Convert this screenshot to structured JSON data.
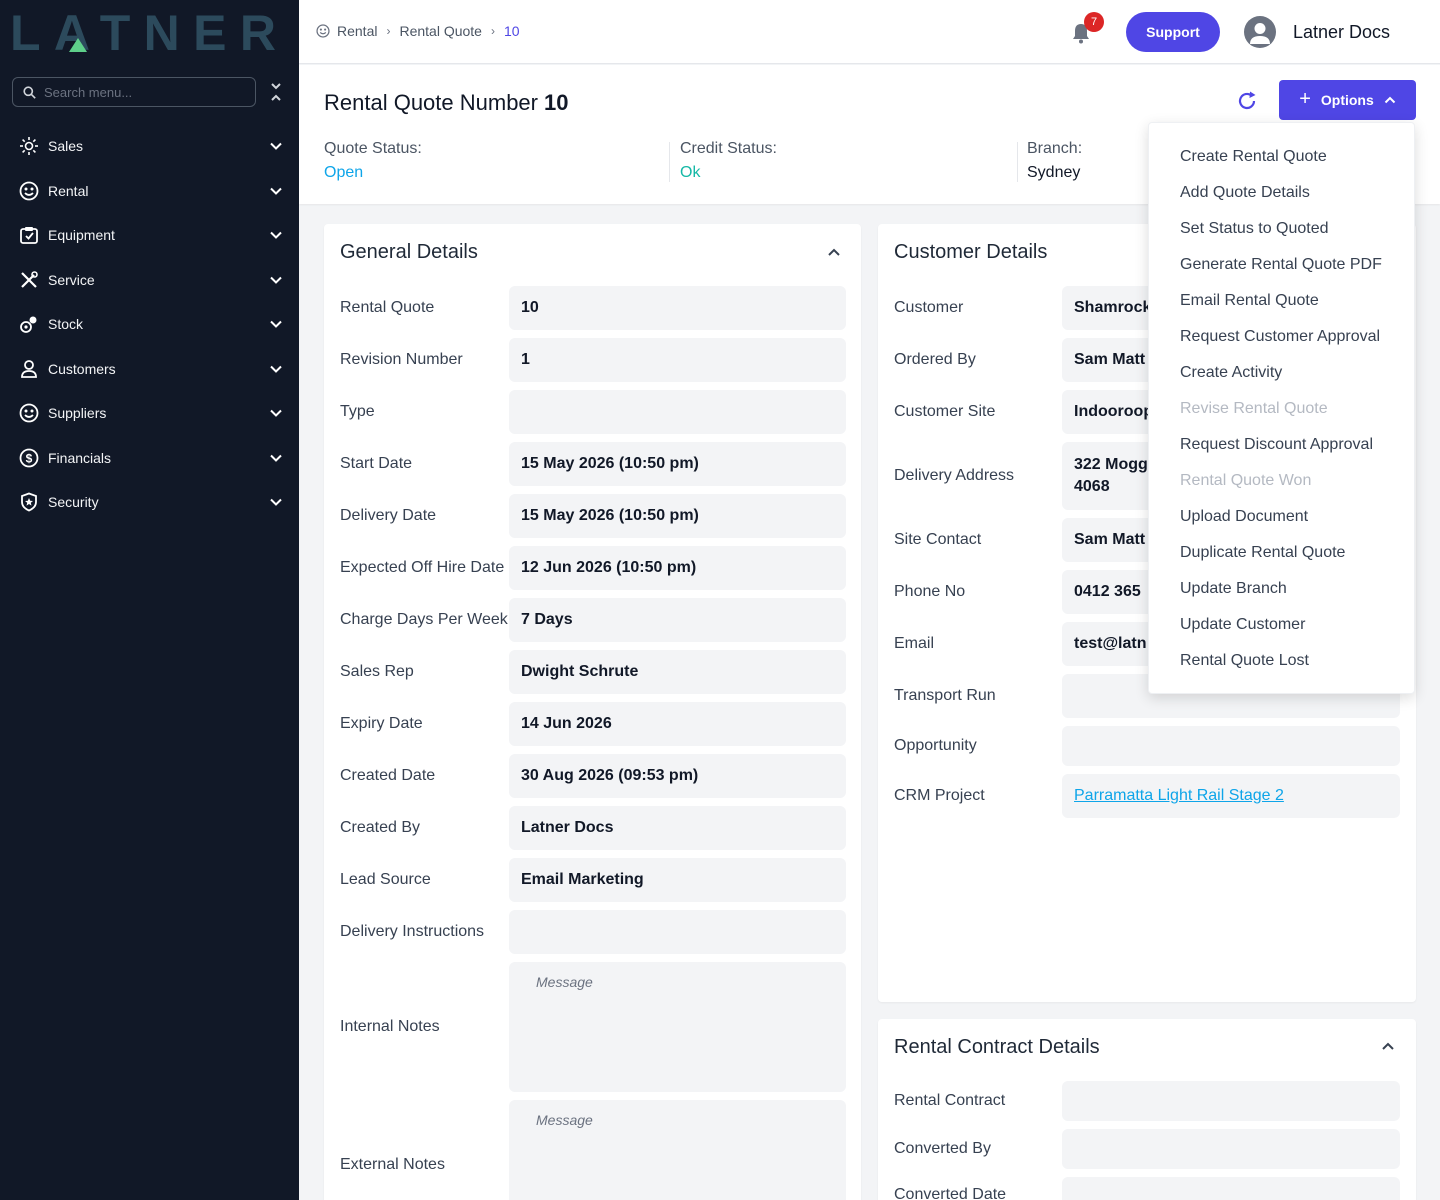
{
  "sidebar": {
    "logo_text": "LATNER",
    "search_placeholder": "Search menu...",
    "items": [
      {
        "label": "Sales",
        "icon": "sales-icon"
      },
      {
        "label": "Rental",
        "icon": "rental-icon"
      },
      {
        "label": "Equipment",
        "icon": "equipment-icon"
      },
      {
        "label": "Service",
        "icon": "service-icon"
      },
      {
        "label": "Stock",
        "icon": "stock-icon"
      },
      {
        "label": "Customers",
        "icon": "customers-icon"
      },
      {
        "label": "Suppliers",
        "icon": "suppliers-icon"
      },
      {
        "label": "Financials",
        "icon": "financials-icon"
      },
      {
        "label": "Security",
        "icon": "security-icon"
      }
    ]
  },
  "header": {
    "breadcrumb": [
      "Rental",
      "Rental Quote",
      "10"
    ],
    "notification_count": "7",
    "support_label": "Support",
    "user_name": "Latner Docs"
  },
  "title": {
    "label": "Rental Quote Number",
    "number": "10",
    "options_label": "Options",
    "quote_status_label": "Quote Status:",
    "quote_status_value": "Open",
    "credit_status_label": "Credit Status:",
    "credit_status_value": "Ok",
    "branch_label": "Branch:",
    "branch_value": "Sydney"
  },
  "general": {
    "title": "General Details",
    "rows": [
      {
        "label": "Rental Quote",
        "value": "10"
      },
      {
        "label": "Revision Number",
        "value": "1"
      },
      {
        "label": "Type",
        "value": ""
      },
      {
        "label": "Start Date",
        "value": "15 May 2026 (10:50 pm)"
      },
      {
        "label": "Delivery Date",
        "value": "15 May 2026 (10:50 pm)"
      },
      {
        "label": "Expected Off Hire Date",
        "value": "12 Jun 2026 (10:50 pm)"
      },
      {
        "label": "Charge Days Per Week",
        "value": "7 Days"
      },
      {
        "label": "Sales Rep",
        "value": "Dwight Schrute"
      },
      {
        "label": "Expiry Date",
        "value": "14 Jun 2026"
      },
      {
        "label": "Created Date",
        "value": "30 Aug 2026 (09:53 pm)"
      },
      {
        "label": "Created By",
        "value": "Latner Docs"
      },
      {
        "label": "Lead Source",
        "value": "Email Marketing"
      },
      {
        "label": "Delivery Instructions",
        "value": ""
      }
    ],
    "internal_notes_label": "Internal Notes",
    "internal_notes_placeholder": "Message",
    "external_notes_label": "External Notes",
    "external_notes_placeholder": "Message"
  },
  "customer": {
    "title": "Customer Details",
    "customer_label": "Customer",
    "customer_value": "Shamrock",
    "ordered_by_label": "Ordered By",
    "ordered_by_value": "Sam Matt",
    "site_label": "Customer Site",
    "site_value": "Indooroop",
    "address_label": "Delivery Address",
    "address_line1": "322 Mogg",
    "address_line2": "4068",
    "site_contact_label": "Site Contact",
    "site_contact_value": "Sam Matt",
    "phone_label": "Phone No",
    "phone_value": "0412 365",
    "email_label": "Email",
    "email_value": "test@latn",
    "transport_label": "Transport Run",
    "transport_value": "",
    "opportunity_label": "Opportunity",
    "opportunity_value": "",
    "crm_label": "CRM Project",
    "crm_value": "Parramatta Light Rail Stage 2"
  },
  "contract": {
    "title": "Rental Contract Details",
    "rental_contract_label": "Rental Contract",
    "converted_by_label": "Converted By",
    "converted_date_label": "Converted Date"
  },
  "options_menu": [
    {
      "label": "Create Rental Quote",
      "disabled": false
    },
    {
      "label": "Add Quote Details",
      "disabled": false
    },
    {
      "label": "Set Status to Quoted",
      "disabled": false
    },
    {
      "label": "Generate Rental Quote PDF",
      "disabled": false
    },
    {
      "label": "Email Rental Quote",
      "disabled": false
    },
    {
      "label": "Request Customer Approval",
      "disabled": false
    },
    {
      "label": "Create Activity",
      "disabled": false
    },
    {
      "label": "Revise Rental Quote",
      "disabled": true
    },
    {
      "label": "Request Discount Approval",
      "disabled": false
    },
    {
      "label": "Rental Quote Won",
      "disabled": true
    },
    {
      "label": "Upload Document",
      "disabled": false
    },
    {
      "label": "Duplicate Rental Quote",
      "disabled": false
    },
    {
      "label": "Update Branch",
      "disabled": false
    },
    {
      "label": "Update Customer",
      "disabled": false
    },
    {
      "label": "Rental Quote Lost",
      "disabled": false
    }
  ],
  "colors": {
    "sidebar_bg": "#111827",
    "accent": "#4f46e5",
    "status_open": "#0ea5e9",
    "status_ok": "#14b8a6",
    "badge": "#dc2626"
  }
}
